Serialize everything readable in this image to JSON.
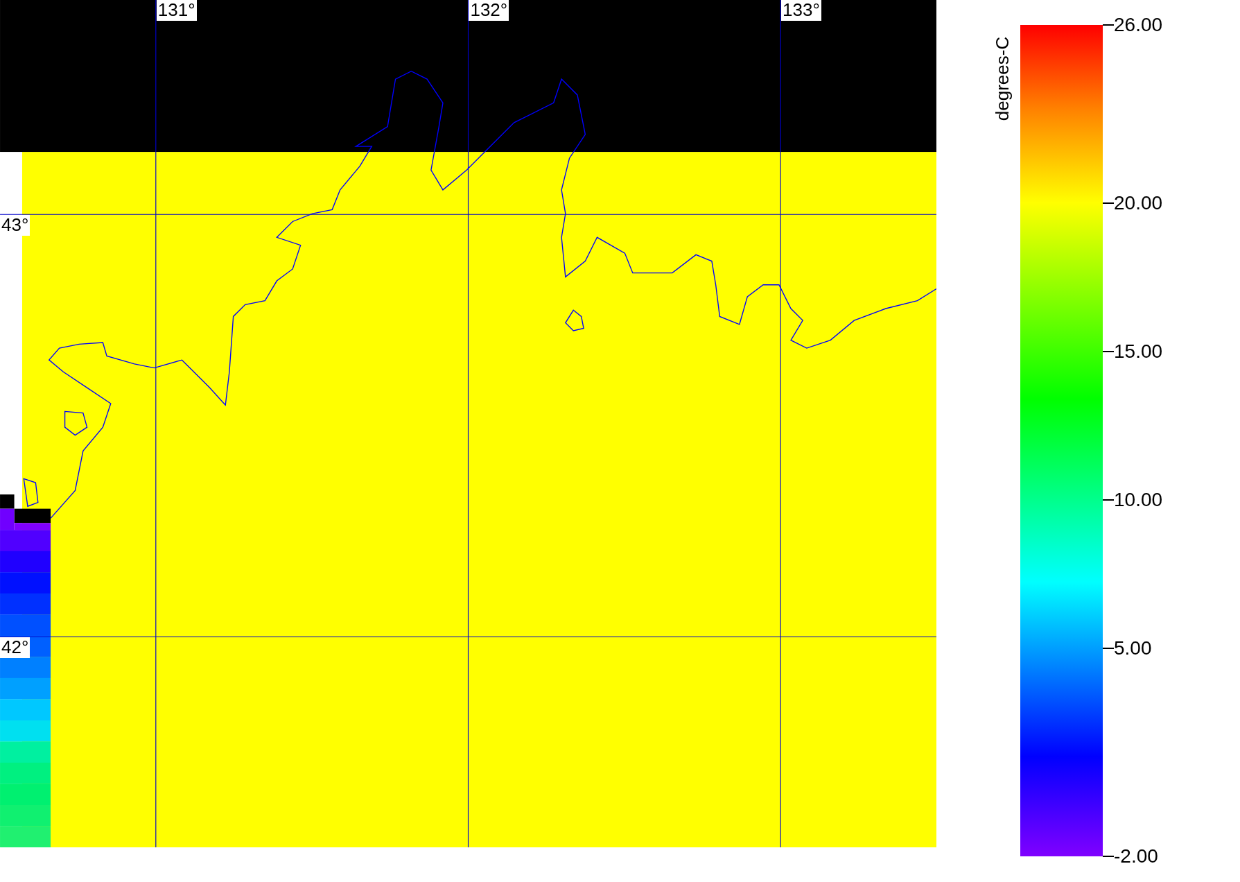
{
  "map": {
    "lon_labels": [
      "131°",
      "132°",
      "133°"
    ],
    "lat_labels": [
      "43°",
      "42°"
    ]
  },
  "colorbar": {
    "title": "degrees-C",
    "tick_labels": [
      "26.00",
      "20.00",
      "15.00",
      "10.00",
      "5.00",
      "-2.00"
    ]
  }
}
